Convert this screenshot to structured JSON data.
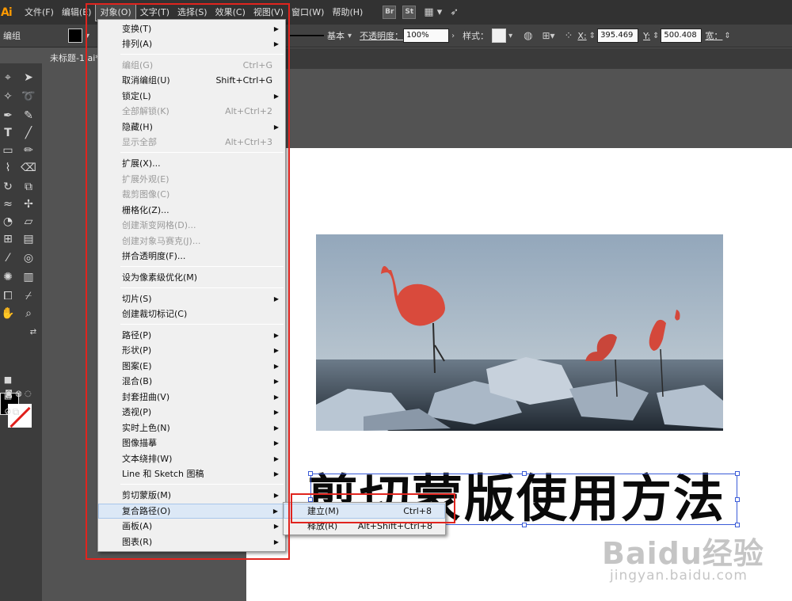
{
  "app": {
    "logo": "Ai"
  },
  "menubar": {
    "items": [
      "文件(F)",
      "编辑(E)",
      "对象(O)",
      "文字(T)",
      "选择(S)",
      "效果(C)",
      "视图(V)",
      "窗口(W)",
      "帮助(H)"
    ],
    "active_index": 2,
    "bridge_label": "Br",
    "stock_label": "St"
  },
  "controlbar": {
    "selection_label": "编组",
    "stroke_style": "基本",
    "opacity_label": "不透明度：",
    "opacity_value": "100%",
    "style_label": "样式：",
    "x_label": "X:",
    "x_value": "395.469",
    "y_label": "Y:",
    "y_value": "500.408",
    "w_label": "宽："
  },
  "document": {
    "tab_title": "未标题-1.ai*"
  },
  "artwork": {
    "heading": "剪切蒙版使用方法"
  },
  "object_menu": {
    "items": [
      {
        "label": "变换(T)",
        "shortcut": "",
        "submenu": true,
        "disabled": false
      },
      {
        "label": "排列(A)",
        "shortcut": "",
        "submenu": true,
        "disabled": false
      },
      {
        "label": "编组(G)",
        "shortcut": "Ctrl+G",
        "submenu": false,
        "disabled": true
      },
      {
        "label": "取消编组(U)",
        "shortcut": "Shift+Ctrl+G",
        "submenu": false,
        "disabled": false
      },
      {
        "label": "锁定(L)",
        "shortcut": "",
        "submenu": true,
        "disabled": false
      },
      {
        "label": "全部解锁(K)",
        "shortcut": "Alt+Ctrl+2",
        "submenu": false,
        "disabled": true
      },
      {
        "label": "隐藏(H)",
        "shortcut": "",
        "submenu": true,
        "disabled": false
      },
      {
        "label": "显示全部",
        "shortcut": "Alt+Ctrl+3",
        "submenu": false,
        "disabled": true
      },
      {
        "label": "扩展(X)...",
        "shortcut": "",
        "submenu": false,
        "disabled": false
      },
      {
        "label": "扩展外观(E)",
        "shortcut": "",
        "submenu": false,
        "disabled": true
      },
      {
        "label": "裁剪图像(C)",
        "shortcut": "",
        "submenu": false,
        "disabled": true
      },
      {
        "label": "栅格化(Z)...",
        "shortcut": "",
        "submenu": false,
        "disabled": false
      },
      {
        "label": "创建渐变网格(D)...",
        "shortcut": "",
        "submenu": false,
        "disabled": true
      },
      {
        "label": "创建对象马赛克(J)...",
        "shortcut": "",
        "submenu": false,
        "disabled": true
      },
      {
        "label": "拼合透明度(F)...",
        "shortcut": "",
        "submenu": false,
        "disabled": false
      },
      {
        "label": "设为像素级优化(M)",
        "shortcut": "",
        "submenu": false,
        "disabled": false
      },
      {
        "label": "切片(S)",
        "shortcut": "",
        "submenu": true,
        "disabled": false
      },
      {
        "label": "创建裁切标记(C)",
        "shortcut": "",
        "submenu": false,
        "disabled": false
      },
      {
        "label": "路径(P)",
        "shortcut": "",
        "submenu": true,
        "disabled": false
      },
      {
        "label": "形状(P)",
        "shortcut": "",
        "submenu": true,
        "disabled": false
      },
      {
        "label": "图案(E)",
        "shortcut": "",
        "submenu": true,
        "disabled": false
      },
      {
        "label": "混合(B)",
        "shortcut": "",
        "submenu": true,
        "disabled": false
      },
      {
        "label": "封套扭曲(V)",
        "shortcut": "",
        "submenu": true,
        "disabled": false
      },
      {
        "label": "透视(P)",
        "shortcut": "",
        "submenu": true,
        "disabled": false
      },
      {
        "label": "实时上色(N)",
        "shortcut": "",
        "submenu": true,
        "disabled": false
      },
      {
        "label": "图像描摹",
        "shortcut": "",
        "submenu": true,
        "disabled": false
      },
      {
        "label": "文本绕排(W)",
        "shortcut": "",
        "submenu": true,
        "disabled": false
      },
      {
        "label": "Line 和 Sketch 图稿",
        "shortcut": "",
        "submenu": true,
        "disabled": false
      },
      {
        "label": "剪切蒙版(M)",
        "shortcut": "",
        "submenu": true,
        "disabled": false
      },
      {
        "label": "复合路径(O)",
        "shortcut": "",
        "submenu": true,
        "disabled": false,
        "hover": true
      },
      {
        "label": "画板(A)",
        "shortcut": "",
        "submenu": true,
        "disabled": false
      },
      {
        "label": "图表(R)",
        "shortcut": "",
        "submenu": true,
        "disabled": false
      }
    ]
  },
  "compound_submenu": {
    "items": [
      {
        "label": "建立(M)",
        "shortcut": "Ctrl+8",
        "hover": true
      },
      {
        "label": "释放(R)",
        "shortcut": "Alt+Shift+Ctrl+8",
        "hover": false
      }
    ]
  },
  "watermark": {
    "brand": "Baidu经验",
    "url": "jingyan.baidu.com"
  },
  "colors": {
    "annotation": "#e0241e",
    "selection": "#3a5bd8",
    "accent": "#ff9a00"
  }
}
